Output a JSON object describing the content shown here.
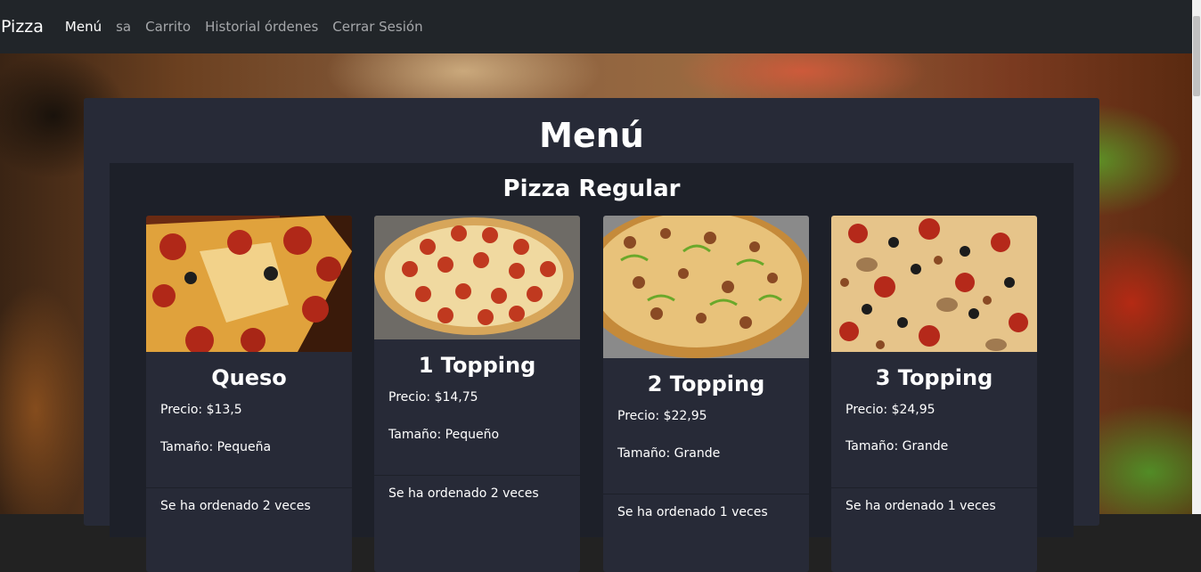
{
  "navbar": {
    "brand": "Pizza",
    "links": [
      {
        "label": "Menú",
        "active": true
      },
      {
        "label": "sa",
        "active": false
      },
      {
        "label": "Carrito",
        "active": false
      },
      {
        "label": "Historial órdenes",
        "active": false
      },
      {
        "label": "Cerrar Sesión",
        "active": false
      }
    ]
  },
  "page": {
    "title": "Menú"
  },
  "section": {
    "title": "Pizza Regular",
    "cards": [
      {
        "name": "Queso",
        "price": "Precio: $13,5",
        "size": "Tamaño: Pequeña",
        "orders": "Se ha ordenado 2 veces",
        "image": "pepperoni-slice-pizza"
      },
      {
        "name": "1 Topping",
        "price": "Precio: $14,75",
        "size": "Tamaño: Pequeño",
        "orders": "Se ha ordenado 2 veces",
        "image": "pepperoni-pizza"
      },
      {
        "name": "2 Topping",
        "price": "Precio: $22,95",
        "size": "Tamaño: Grande",
        "orders": "Se ha ordenado 1 veces",
        "image": "green-pepper-sausage-pizza"
      },
      {
        "name": "3 Topping",
        "price": "Precio: $24,95",
        "size": "Tamaño: Grande",
        "orders": "Se ha ordenado 1 veces",
        "image": "supreme-pizza"
      }
    ]
  },
  "colors": {
    "navbar": "#212529",
    "panel": "#272a37",
    "section": "#1d2029",
    "nav_muted": "#a5a7aa"
  }
}
